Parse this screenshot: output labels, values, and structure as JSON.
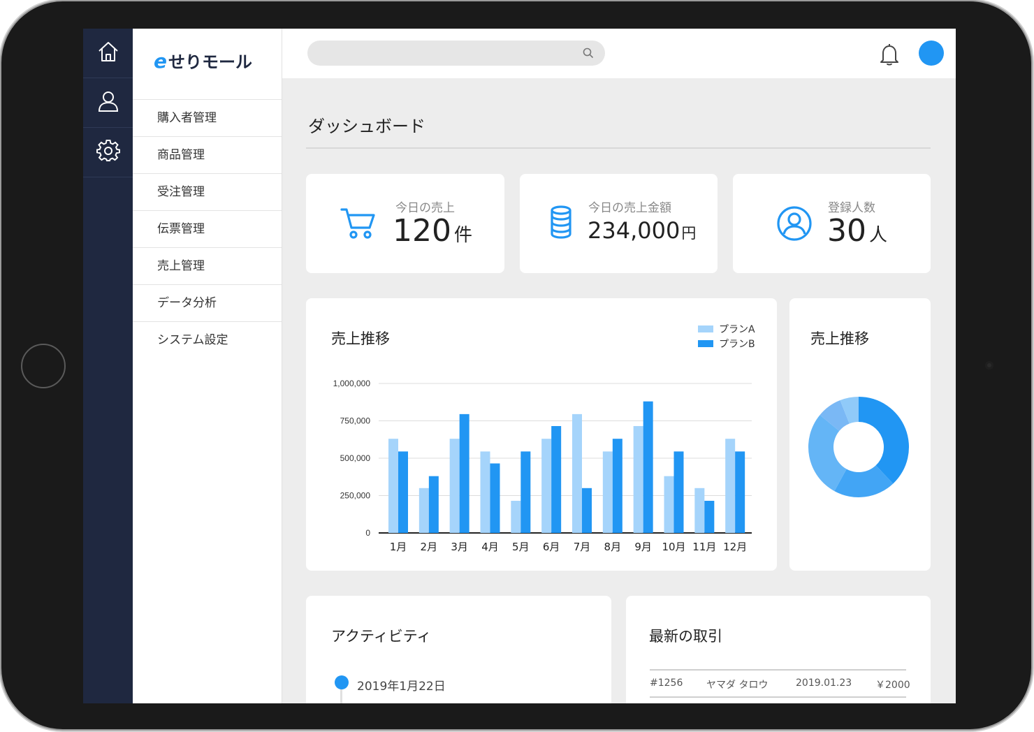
{
  "rail": {
    "items": [
      {
        "icon": "home-icon"
      },
      {
        "icon": "user-icon"
      },
      {
        "icon": "gear-icon"
      }
    ]
  },
  "brand": {
    "mark": "e",
    "name": "せりモール"
  },
  "menu": {
    "items": [
      "購入者管理",
      "商品管理",
      "受注管理",
      "伝票管理",
      "売上管理",
      "データ分析",
      "システム設定"
    ]
  },
  "topbar": {
    "search_placeholder": "",
    "search_icon": "search-icon",
    "bell_icon": "bell-icon"
  },
  "page": {
    "title": "ダッシュボード"
  },
  "stats": [
    {
      "label": "今日の売上",
      "value": "120",
      "unit": "件",
      "icon": "cart-icon"
    },
    {
      "label": "今日の売上金額",
      "value": "234,000",
      "unit": "円",
      "icon": "coins-icon"
    },
    {
      "label": "登録人数",
      "value": "30",
      "unit": "人",
      "icon": "user-circle-icon"
    }
  ],
  "colors": {
    "rail": "#1f2840",
    "accent": "#2196f3",
    "planA": "#a5d4fb",
    "planB": "#2196f3"
  },
  "sales_chart": {
    "title": "売上推移"
  },
  "donut_chart": {
    "title": "売上推移"
  },
  "chart_data": [
    {
      "type": "bar",
      "title": "売上推移",
      "categories": [
        "1月",
        "2月",
        "3月",
        "4月",
        "5月",
        "6月",
        "7月",
        "8月",
        "9月",
        "10月",
        "11月",
        "12月"
      ],
      "series": [
        {
          "name": "プランA",
          "values": [
            630000,
            300000,
            630000,
            545000,
            215000,
            630000,
            795000,
            545000,
            715000,
            380000,
            300000,
            630000
          ]
        },
        {
          "name": "プランB",
          "values": [
            545000,
            380000,
            795000,
            465000,
            545000,
            715000,
            300000,
            630000,
            880000,
            545000,
            215000,
            545000
          ]
        }
      ],
      "ylim": [
        0,
        1000000
      ],
      "yticks": [
        0,
        250000,
        500000,
        750000,
        1000000
      ],
      "ytick_labels": [
        "0",
        "250,000",
        "500,000",
        "750,000",
        "1,000,000"
      ],
      "grid": true,
      "legend": "top-right"
    },
    {
      "type": "pie",
      "title": "売上推移",
      "donut": true,
      "values": [
        38,
        20,
        28,
        8,
        6
      ],
      "colors": [
        "#2196f3",
        "#42a5f5",
        "#64b5f6",
        "#7ab8f5",
        "#90caf9"
      ]
    }
  ],
  "activity": {
    "title": "アクティビティ",
    "entries": [
      {
        "date": "2019年1月22日"
      }
    ]
  },
  "transactions": {
    "title": "最新の取引",
    "rows": [
      {
        "id": "#1256",
        "name": "ヤマダ タロウ",
        "date": "2019.01.23",
        "amount": "￥2000"
      }
    ]
  }
}
